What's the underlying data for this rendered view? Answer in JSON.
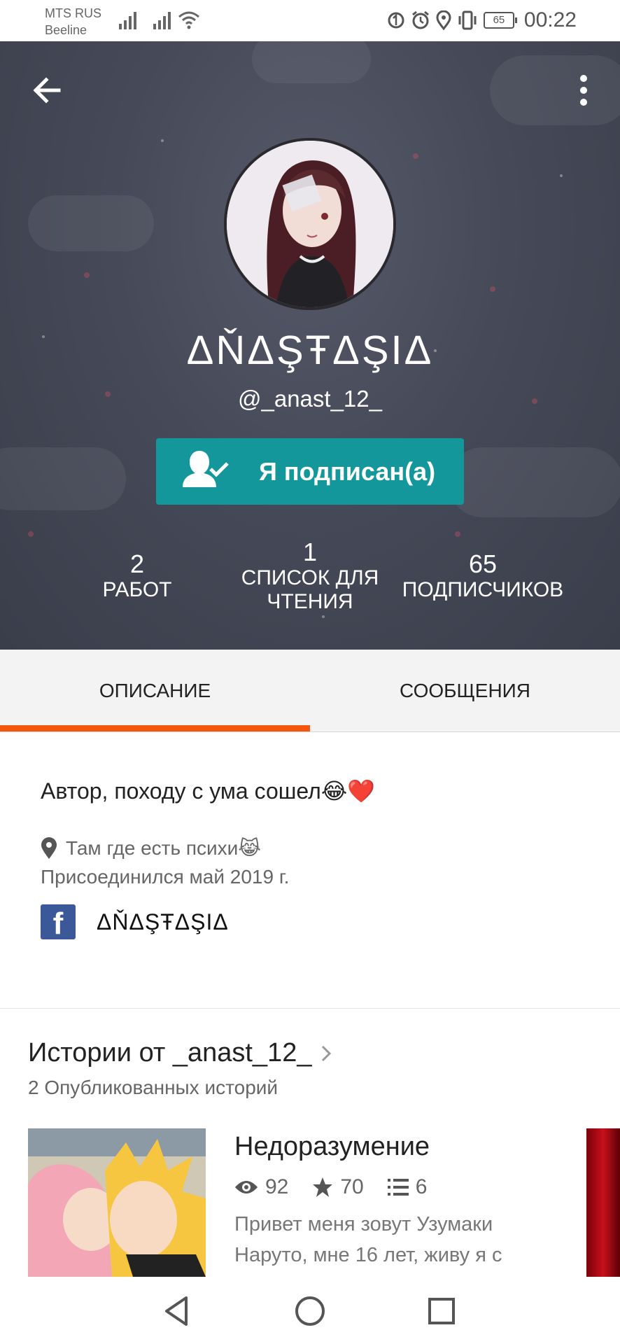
{
  "status_bar": {
    "carrier_1": "MTS RUS",
    "carrier_2": "Beeline",
    "battery": "65",
    "time": "00:22"
  },
  "profile": {
    "display_name": "ΔŇΔŞŦΔŞIΔ",
    "username": "@_anast_12_",
    "follow_button_label": "Я подписан(а)",
    "stats": [
      {
        "value": "2",
        "label": "РАБОТ"
      },
      {
        "value": "1",
        "label": "СПИСОК ДЛЯ ЧТЕНИЯ"
      },
      {
        "value": "65",
        "label": "ПОДПИСЧИКОВ"
      }
    ]
  },
  "tabs": [
    {
      "label": "ОПИСАНИЕ",
      "active": true
    },
    {
      "label": "СООБЩЕНИЯ",
      "active": false
    }
  ],
  "description": {
    "text": "Автор, походу с ума сошел😂❤️",
    "location": "Там где есть психи😹",
    "joined": "Присоединился май 2019 г.",
    "social_name": "ΔŇΔŞŦΔŞIΔ"
  },
  "stories": {
    "title": "Истории от _anast_12_",
    "count": "2 Опубликованных историй",
    "items": [
      {
        "title": "Недоразумение",
        "reads": "92",
        "votes": "70",
        "parts": "6",
        "description": "Привет меня зовут Узумаки Наруто, мне 16 лет, живу я с"
      }
    ]
  },
  "colors": {
    "accent": "#f5560e",
    "follow_button": "#13979b",
    "header_bg": "#464a58"
  }
}
